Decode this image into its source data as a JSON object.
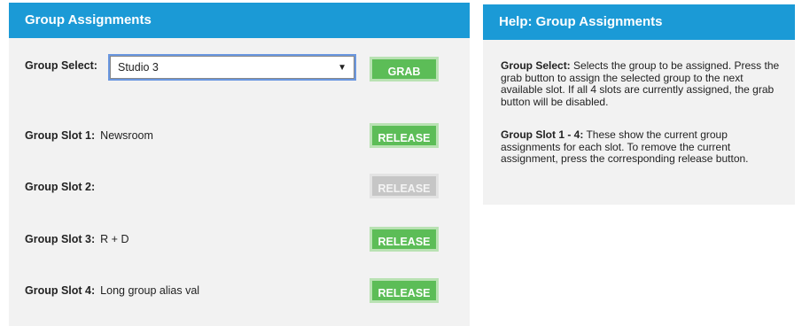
{
  "left_panel": {
    "title": "Group Assignments",
    "group_select": {
      "label": "Group Select:",
      "selected": "Studio 3",
      "grab_label": "GRAB"
    },
    "slots": [
      {
        "label": "Group Slot 1:",
        "value": "Newsroom",
        "button": "RELEASE",
        "enabled": true
      },
      {
        "label": "Group Slot 2:",
        "value": "",
        "button": "RELEASE",
        "enabled": false
      },
      {
        "label": "Group Slot 3:",
        "value": "R + D",
        "button": "RELEASE",
        "enabled": true
      },
      {
        "label": "Group Slot 4:",
        "value": "Long group alias val",
        "button": "RELEASE",
        "enabled": true
      }
    ]
  },
  "help_panel": {
    "title": "Help: Group Assignments",
    "paragraphs": [
      {
        "term": "Group Select:",
        "text": "Selects the group to be assigned. Press the grab button to assign the selected group to the next available slot. If all 4 slots are currently assigned, the grab button will be disabled."
      },
      {
        "term": "Group Slot 1 - 4:",
        "text": "These show the current group assignments for each slot. To remove the current assignment, press the corresponding release button."
      }
    ]
  },
  "colors": {
    "header_blue": "#1b9ad6",
    "button_green": "#5cbd57",
    "button_disabled": "#c6c6c6",
    "panel_bg": "#f2f2f2"
  }
}
